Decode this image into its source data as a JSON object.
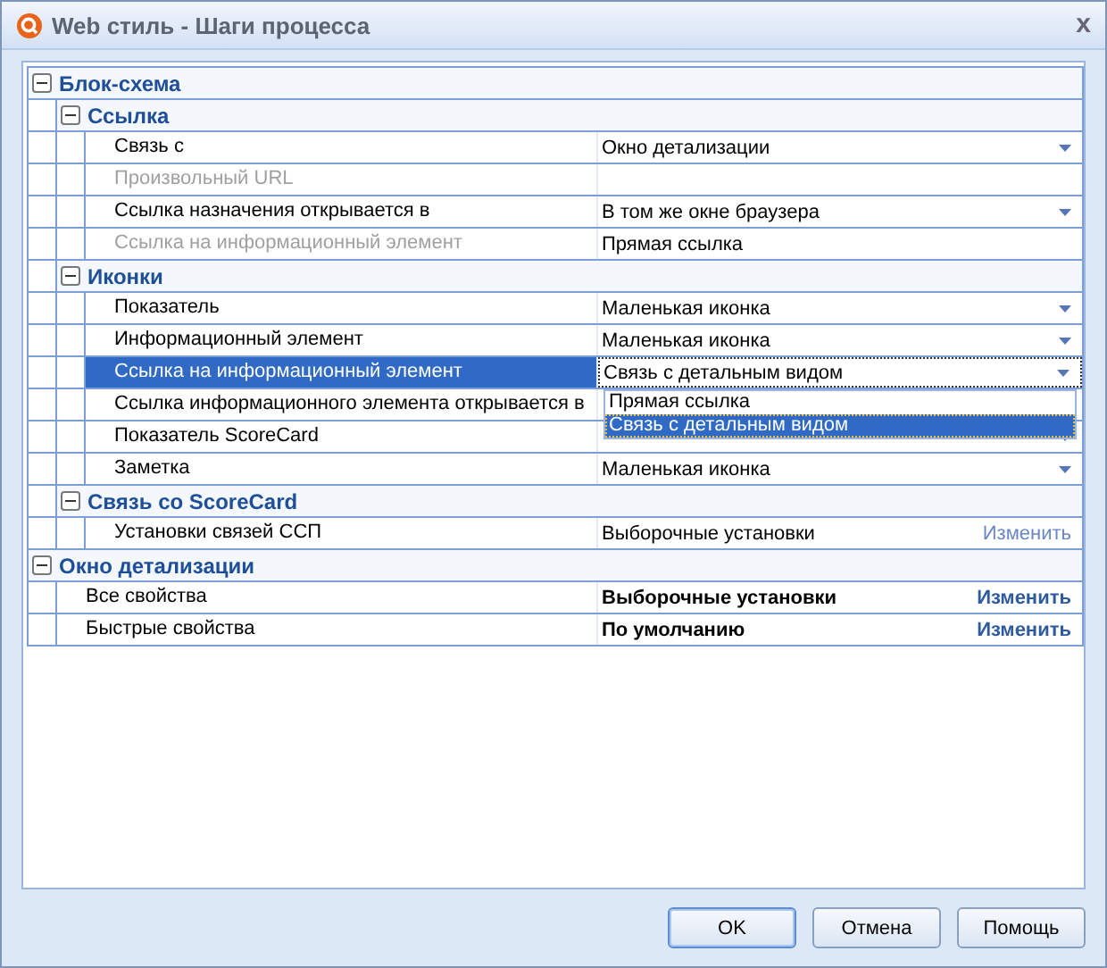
{
  "window": {
    "title": "Web стиль - Шаги процесса",
    "close": "x"
  },
  "groups": [
    {
      "kind": "group",
      "title": "Блок-схема",
      "expanded": true,
      "children": [
        {
          "kind": "group",
          "title": "Ссылка",
          "expanded": true,
          "children": [
            {
              "kind": "dropdown",
              "label": "Связь с",
              "value": "Окно детализации",
              "disabled": false,
              "selected": false
            },
            {
              "kind": "text",
              "label": "Произвольный URL",
              "disabled": true,
              "selected": false
            },
            {
              "kind": "dropdown",
              "label": "Ссылка назначения открывается в",
              "value": "В том же окне браузера",
              "disabled": false,
              "selected": false
            },
            {
              "kind": "text",
              "label": "Ссылка на информационный элемент",
              "value": "Прямая ссылка",
              "disabled": true,
              "selected": false
            }
          ]
        },
        {
          "kind": "group",
          "title": "Иконки",
          "expanded": true,
          "children": [
            {
              "kind": "dropdown",
              "label": "Показатель",
              "value": "Маленькая иконка",
              "disabled": false,
              "selected": false
            },
            {
              "kind": "dropdown",
              "label": "Информационный элемент",
              "value": "Маленькая иконка",
              "disabled": false,
              "selected": false
            },
            {
              "kind": "dropdown",
              "label": "Ссылка на информационный элемент",
              "value": "Связь с детальным видом",
              "disabled": false,
              "selected": true,
              "options": [
                {
                  "label": "Прямая ссылка",
                  "selected": false
                },
                {
                  "label": "Связь с детальным видом",
                  "selected": true
                }
              ]
            },
            {
              "kind": "text",
              "label": "Ссылка информационного элемента открывается в",
              "disabled": false,
              "selected": false
            },
            {
              "kind": "dropdown",
              "label": "Показатель ScoreCard",
              "disabled": false,
              "selected": false
            },
            {
              "kind": "dropdown",
              "label": "Заметка",
              "value": "Маленькая иконка",
              "disabled": false,
              "selected": false
            }
          ]
        },
        {
          "kind": "group",
          "title": "Связь со ScoreCard",
          "expanded": true,
          "children": [
            {
              "kind": "action",
              "label": "Установки связей ССП",
              "value": "Выборочные установки",
              "action": "Изменить",
              "bold": false,
              "disabled": false,
              "selected": false
            }
          ]
        }
      ]
    },
    {
      "kind": "group",
      "title": "Окно детализации",
      "expanded": true,
      "children": [
        {
          "kind": "action",
          "label": "Все свойства",
          "value": "Выборочные установки",
          "action": "Изменить",
          "bold": true,
          "disabled": false,
          "selected": false
        },
        {
          "kind": "action",
          "label": "Быстрые свойства",
          "value": "По умолчанию",
          "action": "Изменить",
          "bold": true,
          "disabled": false,
          "selected": false
        }
      ]
    }
  ],
  "buttons": [
    {
      "label": "OK",
      "default": true
    },
    {
      "label": "Отмена",
      "default": false
    },
    {
      "label": "Помощь",
      "default": false
    }
  ]
}
